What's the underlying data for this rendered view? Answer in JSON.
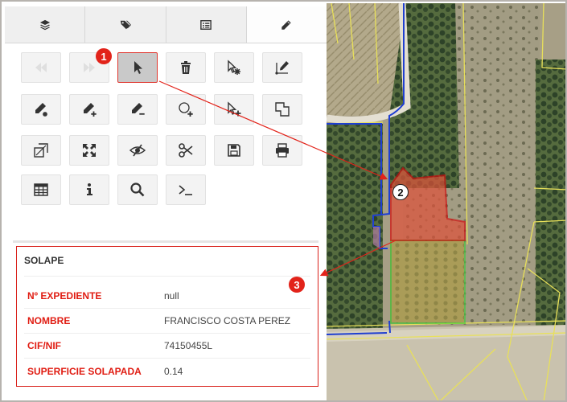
{
  "tabs": [
    {
      "icon": "layers-icon"
    },
    {
      "icon": "tags-icon"
    },
    {
      "icon": "list-icon"
    },
    {
      "icon": "pencil-icon"
    }
  ],
  "toolbar": [
    {
      "icon": "fast-backward-icon",
      "state": "disabled"
    },
    {
      "icon": "fast-forward-icon",
      "state": "disabled"
    },
    {
      "icon": "select-pointer-icon",
      "state": "active"
    },
    {
      "icon": "trash-icon"
    },
    {
      "icon": "select-feature-icon"
    },
    {
      "icon": "draw-line-icon"
    },
    {
      "icon": "edit-vertex-icon"
    },
    {
      "icon": "add-vertex-icon"
    },
    {
      "icon": "remove-vertex-icon"
    },
    {
      "icon": "add-circle-icon"
    },
    {
      "icon": "add-point-icon"
    },
    {
      "icon": "overlap-polygons-icon"
    },
    {
      "icon": "resize-polygon-icon"
    },
    {
      "icon": "move-icon"
    },
    {
      "icon": "hide-icon"
    },
    {
      "icon": "scissors-icon"
    },
    {
      "icon": "save-icon"
    },
    {
      "icon": "print-icon"
    },
    {
      "icon": "table-icon"
    },
    {
      "icon": "info-icon"
    },
    {
      "icon": "search-icon"
    },
    {
      "icon": "terminal-icon"
    }
  ],
  "info_panel": {
    "title": "SOLAPE",
    "rows": [
      {
        "label": "Nº EXPEDIENTE",
        "value": "null"
      },
      {
        "label": "NOMBRE",
        "value": "FRANCISCO COSTA PEREZ"
      },
      {
        "label": "CIF/NIF",
        "value": "74150455L"
      },
      {
        "label": "SUPERFICIE SOLAPADA",
        "value": "0.14"
      }
    ]
  },
  "callouts": [
    {
      "number": "1"
    },
    {
      "number": "2"
    },
    {
      "number": "3"
    }
  ],
  "colors": {
    "callout_red": "#e2231a",
    "overlap_fill": "#e0523a",
    "parcel_blue": "#1f3fd1",
    "parcel_green": "#2fd12f",
    "cadastre_yellow": "#e8e05a"
  }
}
